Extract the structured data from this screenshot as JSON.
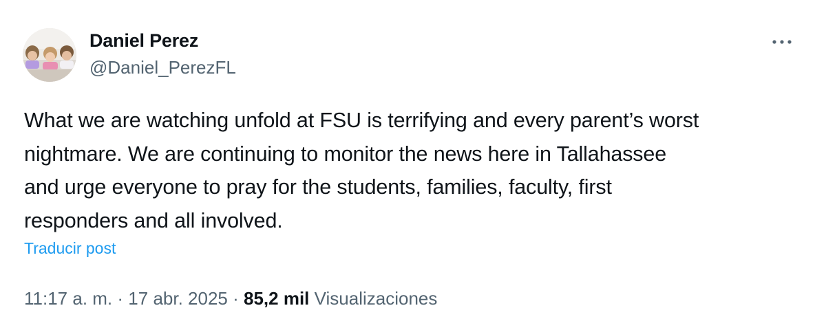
{
  "author": {
    "display_name": "Daniel Perez",
    "handle": "@Daniel_PerezFL",
    "avatar_icon": "profile-photo"
  },
  "more_icon": "ellipsis-icon",
  "post": {
    "text": "What we are watching unfold at FSU is terrifying and every parent’s worst\nnightmare. We are continuing to monitor the news here in Tallahassee\nand urge everyone to pray for the students, families, faculty, first\nresponders and all involved."
  },
  "translate_label": "Traducir post",
  "meta": {
    "time": "11:17 a. m.",
    "date": "17 abr. 2025",
    "separator": "·",
    "views_count": "85,2 mil",
    "views_label": "Visualizaciones"
  },
  "colors": {
    "text_primary": "#0f1419",
    "text_secondary": "#536471",
    "link": "#1d9bf0"
  }
}
